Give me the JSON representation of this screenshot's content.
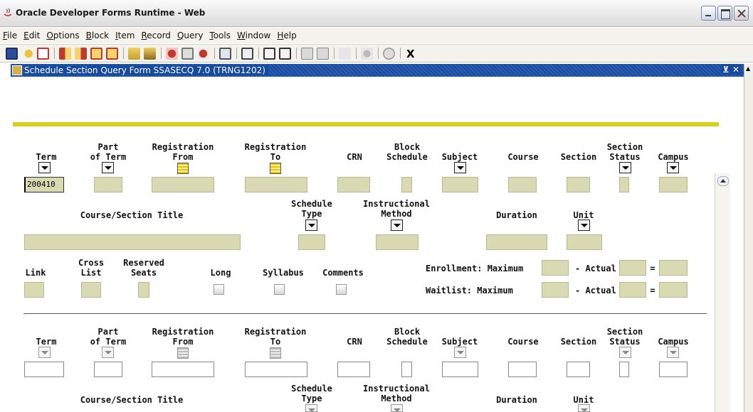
{
  "window": {
    "title": "Oracle Developer Forms Runtime - Web"
  },
  "menu": [
    "File",
    "Edit",
    "Options",
    "Block",
    "Item",
    "Record",
    "Query",
    "Tools",
    "Window",
    "Help"
  ],
  "toolbar": {
    "exit_label": "X"
  },
  "form": {
    "title": "Schedule Section Query Form  SSASECQ  7.0  (TRNG1202)",
    "controls": "⊻ ✕"
  },
  "labels": {
    "term": "Term",
    "part_of_term": "Part\nof Term",
    "registration_from": "Registration\nFrom",
    "registration_to": "Registration\nTo",
    "crn": "CRN",
    "block_schedule": "Block\nSchedule",
    "subject": "Subject",
    "course": "Course",
    "section": "Section",
    "section_status": "Section\nStatus",
    "campus": "Campus",
    "course_section_title": "Course/Section Title",
    "schedule_type": "Schedule\nType",
    "instructional_method": "Instructional\nMethod",
    "duration": "Duration",
    "unit": "Unit",
    "link": "Link",
    "cross_list": "Cross\nList",
    "reserved_seats": "Reserved\nSeats",
    "long": "Long",
    "syllabus": "Syllabus",
    "comments": "Comments",
    "enrollment_maximum": "Enrollment: Maximum",
    "waitlist_maximum": "Waitlist: Maximum",
    "actual": "- Actual",
    "equals": "="
  },
  "record1": {
    "term": "200410"
  }
}
